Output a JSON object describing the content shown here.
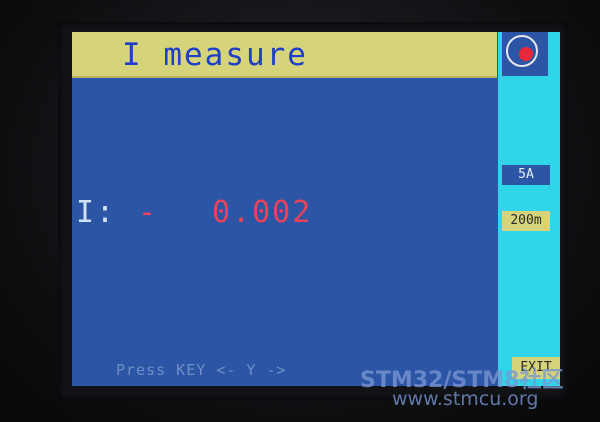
{
  "title": "I measure",
  "reading": {
    "label": "I:",
    "sign": "-",
    "value": "0.002"
  },
  "side_panel": {
    "range_primary": "5A",
    "range_secondary": "200m",
    "exit_label": "EXIT"
  },
  "hint": "Press KEY  <- Y ->",
  "watermark": {
    "line1": "STM32/STM8社区",
    "line2": "www.stmcu.org"
  },
  "colors": {
    "screen_bg": "#2c55a5",
    "title_bar": "#d5d47a",
    "side_panel": "#2fd6ea",
    "value_color": "#e8435a",
    "record_dot": "#e8273a"
  },
  "icons": {
    "record": "record-icon"
  }
}
